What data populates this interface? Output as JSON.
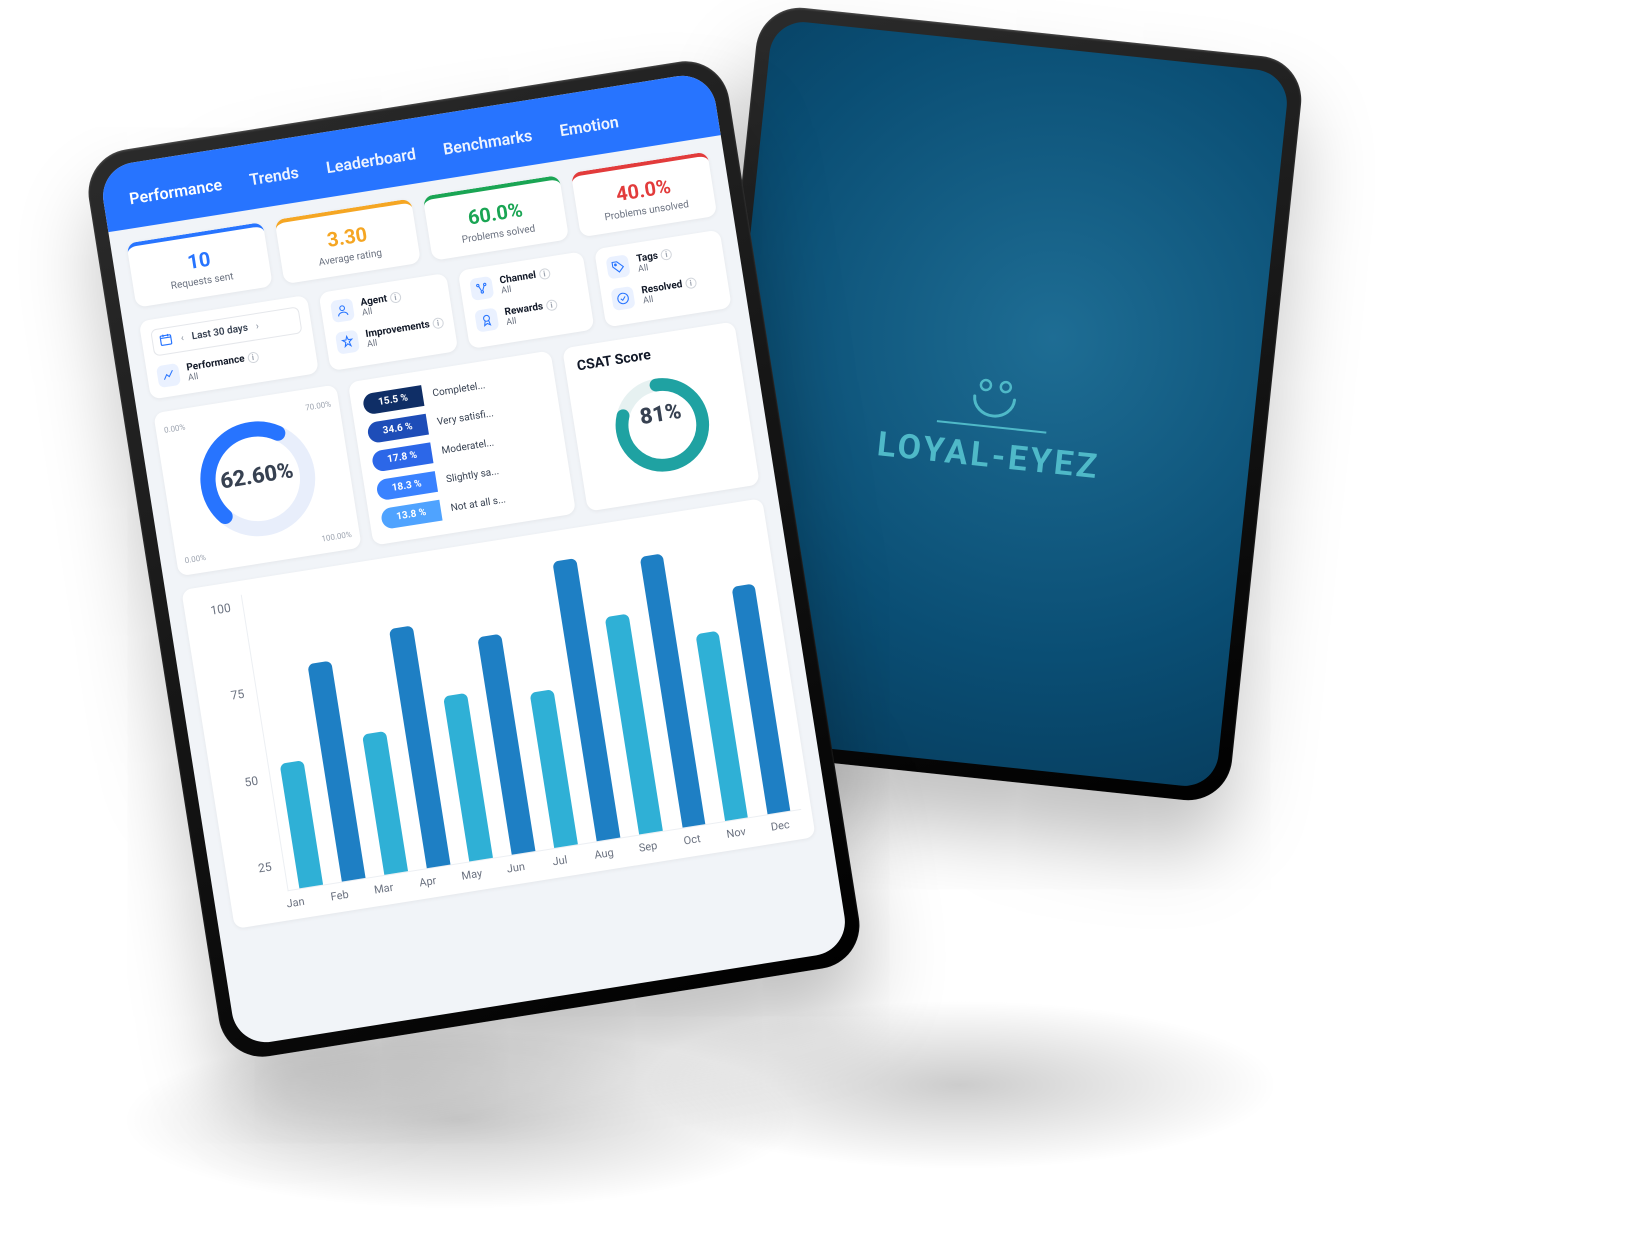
{
  "brand": "LOYAL-EYEZ",
  "tabs": [
    "Performance",
    "Trends",
    "Leaderboard",
    "Benchmarks",
    "Emotion"
  ],
  "active_tab": 0,
  "kpis": [
    {
      "value": "10",
      "label": "Requests sent",
      "color": "blue"
    },
    {
      "value": "3.30",
      "label": "Average rating",
      "color": "amber"
    },
    {
      "value": "60.0%",
      "label": "Problems solved",
      "color": "green"
    },
    {
      "value": "40.0%",
      "label": "Problems unsolved",
      "color": "red"
    }
  ],
  "date_filter": {
    "label": "Last 30 days"
  },
  "filters": [
    {
      "icon": "performance",
      "title": "Performance",
      "value": "All"
    },
    {
      "icon": "agent",
      "title": "Agent",
      "value": "All"
    },
    {
      "icon": "improvements",
      "title": "Improvements",
      "value": "All"
    },
    {
      "icon": "channel",
      "title": "Channel",
      "value": "All"
    },
    {
      "icon": "rewards",
      "title": "Rewards",
      "value": "All"
    },
    {
      "icon": "tags",
      "title": "Tags",
      "value": "All"
    },
    {
      "icon": "resolved",
      "title": "Resolved",
      "value": "All"
    }
  ],
  "gauge": {
    "value": "62.60%",
    "tl": "0.00%",
    "tr": "70.00%",
    "bl": "0.00%",
    "br": "100.00%",
    "pct": 62.6
  },
  "distribution": [
    {
      "pct": "15.5 %",
      "label": "Completel...",
      "color": "#0f2e66"
    },
    {
      "pct": "34.6 %",
      "label": "Very satisfi...",
      "color": "#1e4db8"
    },
    {
      "pct": "17.8 %",
      "label": "Moderatel...",
      "color": "#2c67e8"
    },
    {
      "pct": "18.3 %",
      "label": "Slightly sa...",
      "color": "#3a82ff"
    },
    {
      "pct": "13.8 %",
      "label": "Not at all s...",
      "color": "#4fa3ff"
    }
  ],
  "csat": {
    "title": "CSAT Score",
    "value": "81%",
    "pct": 81
  },
  "chart_data": {
    "type": "bar",
    "categories": [
      "Jan",
      "Feb",
      "Mar",
      "Apr",
      "May",
      "Jun",
      "Jul",
      "Aug",
      "Sep",
      "Oct",
      "Nov",
      "Dec"
    ],
    "values": [
      65,
      95,
      70,
      102,
      78,
      95,
      75,
      115,
      95,
      112,
      85,
      98
    ],
    "series_colors": [
      "#2fb0d6",
      "#1e7fc4",
      "#2fb0d6",
      "#1e7fc4",
      "#2fb0d6",
      "#1e7fc4",
      "#2fb0d6",
      "#1e7fc4",
      "#2fb0d6",
      "#1e7fc4",
      "#2fb0d6",
      "#1e7fc4"
    ],
    "ylabel": "",
    "xlabel": "",
    "yticks": [
      25,
      50,
      75,
      100
    ],
    "ylim": [
      25,
      120
    ]
  }
}
